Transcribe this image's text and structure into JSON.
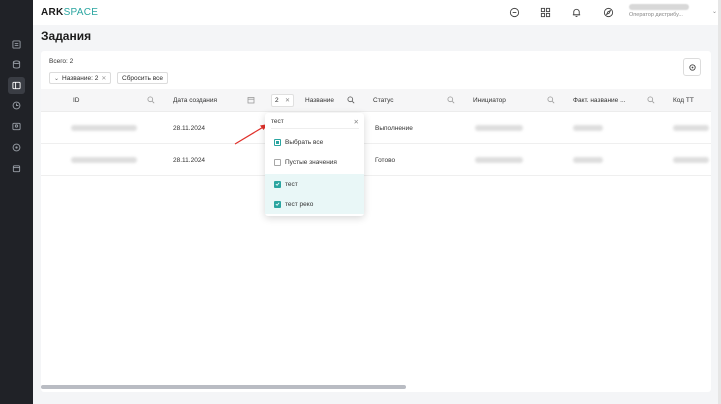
{
  "header": {
    "logo_part1": "ARK",
    "logo_part2": "SPACE",
    "user_role": "Оператор дистрибу...",
    "icons": [
      "chat-icon",
      "grid-icon",
      "bell-icon",
      "compass-icon"
    ]
  },
  "sidebar": {
    "icons": [
      "list-icon",
      "database-icon",
      "panel-icon",
      "clock-icon",
      "people-icon",
      "settings-icon",
      "calendar-icon"
    ],
    "active_index": 2
  },
  "page": {
    "title": "Задания",
    "total": "Всего: 2",
    "filter_chip": "Название: 2",
    "reset_label": "Сбросить все"
  },
  "table": {
    "columns": [
      "ID",
      "Дата создания",
      "Название",
      "Статус",
      "Инициатор",
      "Факт. название ...",
      "Код ТТ"
    ],
    "name_filter_count": "2",
    "rows": [
      {
        "date": "28.11.2024",
        "status": "Выполнение"
      },
      {
        "date": "28.11.2024",
        "status": "Готово"
      }
    ]
  },
  "dropdown": {
    "search_value": "тест",
    "items": [
      {
        "label": "Выбрать все",
        "state": "partial"
      },
      {
        "label": "Пустые значения",
        "state": "unchecked"
      },
      {
        "label": "тест",
        "state": "checked"
      },
      {
        "label": "тест реко",
        "state": "checked"
      }
    ]
  },
  "colors": {
    "accent": "#2aa5a0",
    "sidebar": "#202227",
    "arrow": "#e0302a"
  }
}
